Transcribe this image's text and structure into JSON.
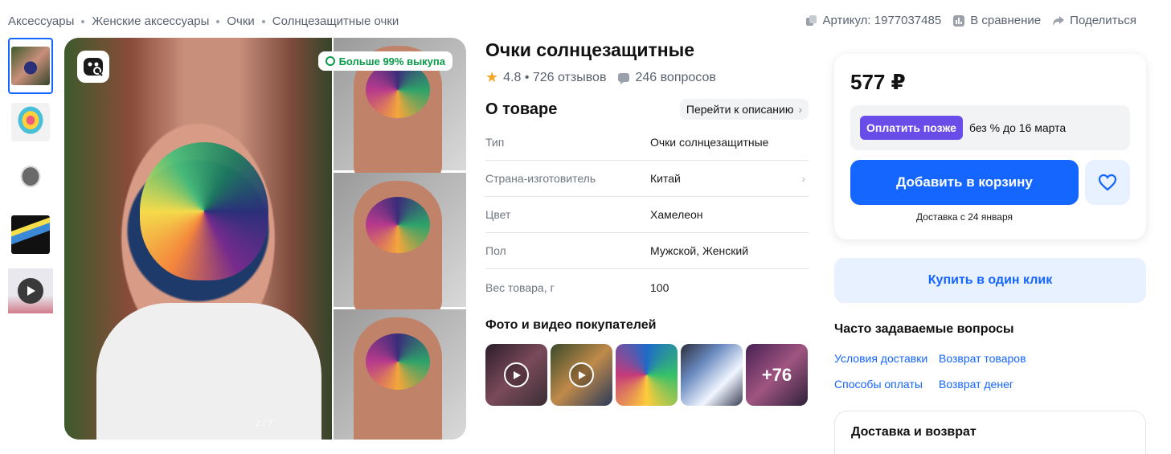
{
  "breadcrumbs": [
    "Аксессуары",
    "Женские аксессуары",
    "Очки",
    "Солнцезащитные очки"
  ],
  "top_actions": {
    "article": "Артикул: 1977037485",
    "compare": "В сравнение",
    "share": "Поделиться"
  },
  "gallery": {
    "badge": "Больше 99% выкупа",
    "counter": "2 / 7",
    "thumb_icons": [
      "image-thumb",
      "image-thumb",
      "image-thumb",
      "image-thumb",
      "video-thumb"
    ]
  },
  "product": {
    "title": "Очки солнцезащитные",
    "rating_text": "4.8 • 726 отзывов",
    "questions": "246 вопросов",
    "about_title": "О товаре",
    "goto_description": "Перейти к описанию",
    "specs": [
      {
        "key": "Тип",
        "value": "Очки солнцезащитные"
      },
      {
        "key": "Страна-изготовитель",
        "value": "Китай"
      },
      {
        "key": "Цвет",
        "value": "Хамелеон"
      },
      {
        "key": "Пол",
        "value": "Мужской, Женский"
      },
      {
        "key": "Вес товара, г",
        "value": "100"
      }
    ],
    "photos_title": "Фото и видео покупателей",
    "photos_more": "+76"
  },
  "buy": {
    "price": "577 ₽",
    "pay_later_tag": "Оплатить позже",
    "pay_later_text": "без % до 16 марта",
    "add_to_cart": "Добавить в корзину",
    "delivery": "Доставка с 24 января",
    "one_click": "Купить в один клик"
  },
  "faq": {
    "title": "Часто задаваемые вопросы",
    "links": [
      "Условия доставки",
      "Возврат товаров",
      "Способы оплаты",
      "Возврат денег"
    ]
  },
  "delivery_card": {
    "title": "Доставка и возврат"
  },
  "colors": {
    "accent": "#1565ff",
    "pay_later": "#6a4de8",
    "badge_green": "#0a9b4a"
  }
}
